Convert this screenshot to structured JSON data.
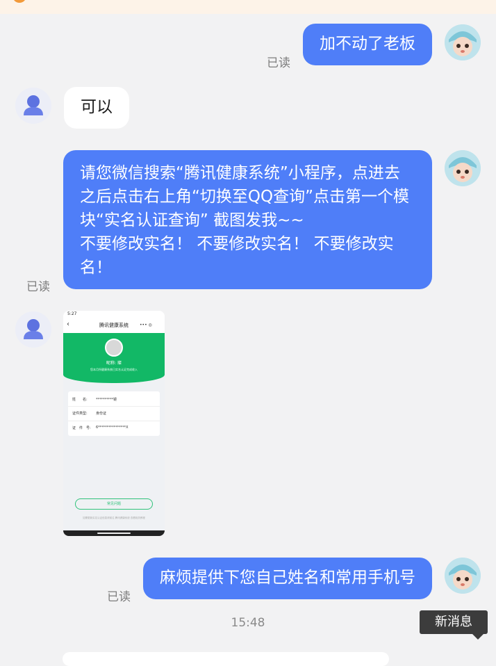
{
  "messages": [
    {
      "from": "me",
      "text": "加不动了老板",
      "status": "已读"
    },
    {
      "from": "other",
      "text": "可以"
    },
    {
      "from": "me",
      "lines": [
        "请您微信搜索“腾讯健康系统”小程序，点进去",
        "之后点击右上角“切换至QQ查询”点击第一个模",
        "块“实名认证查询” 截图发我~~",
        "不要修改实名！ 不要修改实名！ 不要修改实",
        "名！"
      ],
      "status": "已读"
    },
    {
      "from": "other",
      "type": "image",
      "screenshot": {
        "status_time": "5:27",
        "title": "腾讯健康系统",
        "caps": "•••  ◎",
        "nickname": "昵称: 璨",
        "tip": "您本月所健康系统已实名认证完成收入",
        "fields": [
          {
            "label": "姓　　名:",
            "value": "**********镜"
          },
          {
            "label": "证件类型:",
            "value": "身份证"
          },
          {
            "label": "证　件　号:",
            "value": "6****************X"
          }
        ],
        "button": "常见问题",
        "footer": "如需更新实名认证信息请前往 腾讯健康系统 查看相关教程"
      }
    },
    {
      "from": "me",
      "text": "麻烦提供下您自己姓名和常用手机号",
      "status": "已读"
    }
  ],
  "timestamp": "15:48",
  "new_message_tip": "新消息",
  "colors": {
    "my_bubble": "#4f7ef8",
    "background": "#f2f2f3",
    "read_status": "#7d7d7d"
  }
}
